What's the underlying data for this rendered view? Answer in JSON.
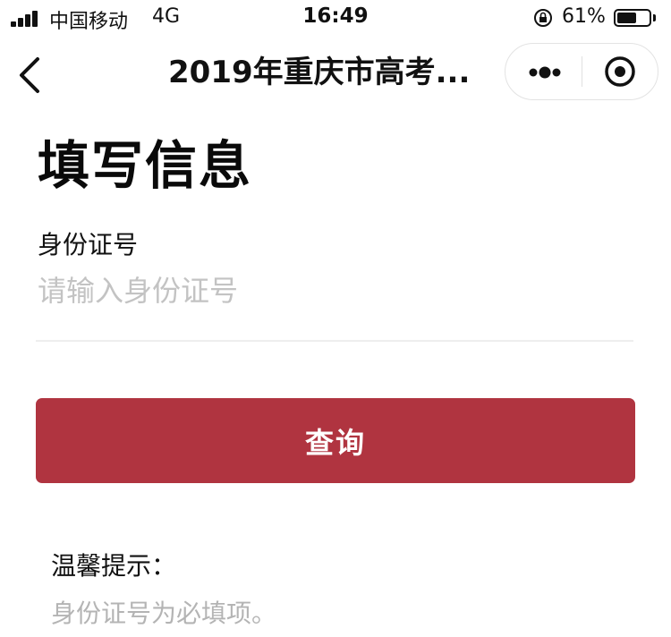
{
  "status_bar": {
    "carrier": "中国移动",
    "network": "4G",
    "time": "16:49",
    "battery_percent": "61%",
    "battery_level": 0.61
  },
  "nav": {
    "title": "2019年重庆市高考..."
  },
  "form": {
    "title": "填写信息",
    "id_label": "身份证号",
    "id_placeholder": "请输入身份证号",
    "id_value": "",
    "submit_label": "查询"
  },
  "tips": {
    "title": "温馨提示：",
    "body": "身份证号为必填项。"
  },
  "colors": {
    "accent": "#b03440",
    "placeholder": "#c3c3c3",
    "hint": "#b4b4b4"
  }
}
